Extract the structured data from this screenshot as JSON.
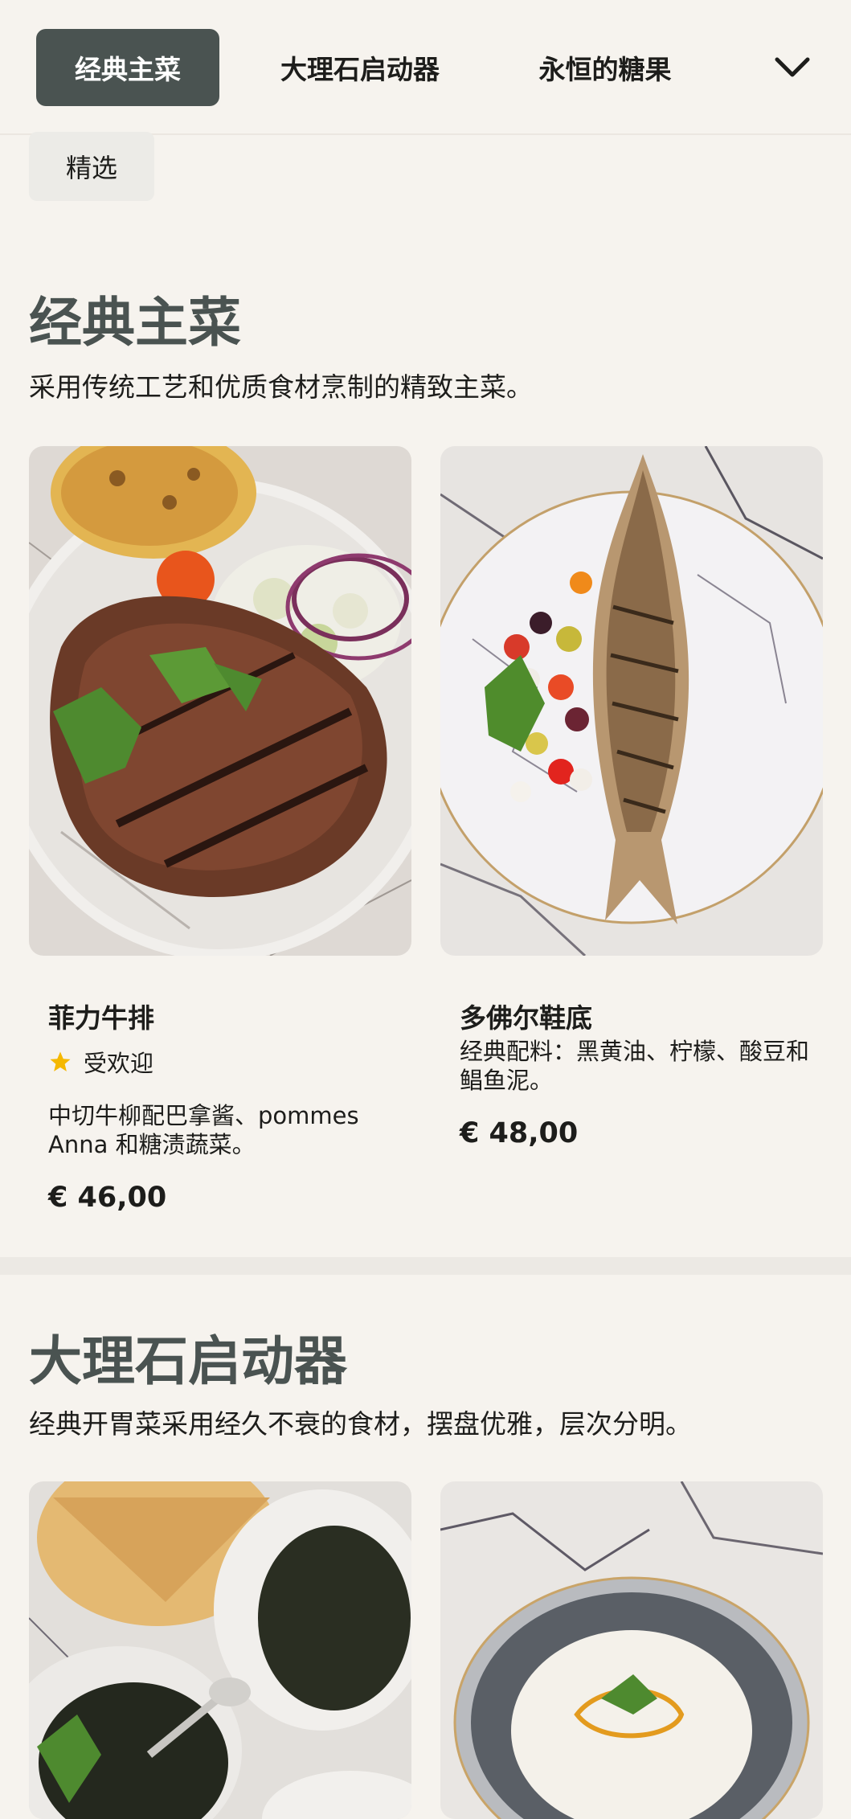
{
  "tabs": [
    {
      "label": "经典主菜",
      "active": true
    },
    {
      "label": "大理石启动器",
      "active": false
    },
    {
      "label": "永恒的糖果",
      "active": false
    }
  ],
  "filter_chip": "精选",
  "sections": [
    {
      "title": "经典主菜",
      "description": "采用传统工艺和优质食材烹制的精致主菜。",
      "items": [
        {
          "name": "菲力牛排",
          "badge": "受欢迎",
          "description": "中切牛柳配巴拿酱、pommes Anna 和糖渍蔬菜。",
          "price": "€ 46,00",
          "image": "grilled-steak-photo"
        },
        {
          "name": "多佛尔鞋底",
          "description": "经典配料：黑黄油、柠檬、酸豆和鲳鱼泥。",
          "price": "€ 48,00",
          "image": "grilled-sole-photo"
        }
      ]
    },
    {
      "title": "大理石启动器",
      "description": "经典开胃菜采用经久不衰的食材，摆盘优雅，层次分明。",
      "items": [
        {
          "image": "caviar-flatbread-photo"
        },
        {
          "image": "cream-soup-bowl-photo"
        }
      ]
    }
  ],
  "icons": {
    "dropdown": "chevron-down-icon",
    "popular": "star-icon"
  },
  "colors": {
    "accent": "#4a5351",
    "background": "#f6f3ee",
    "star": "#f5b800"
  }
}
